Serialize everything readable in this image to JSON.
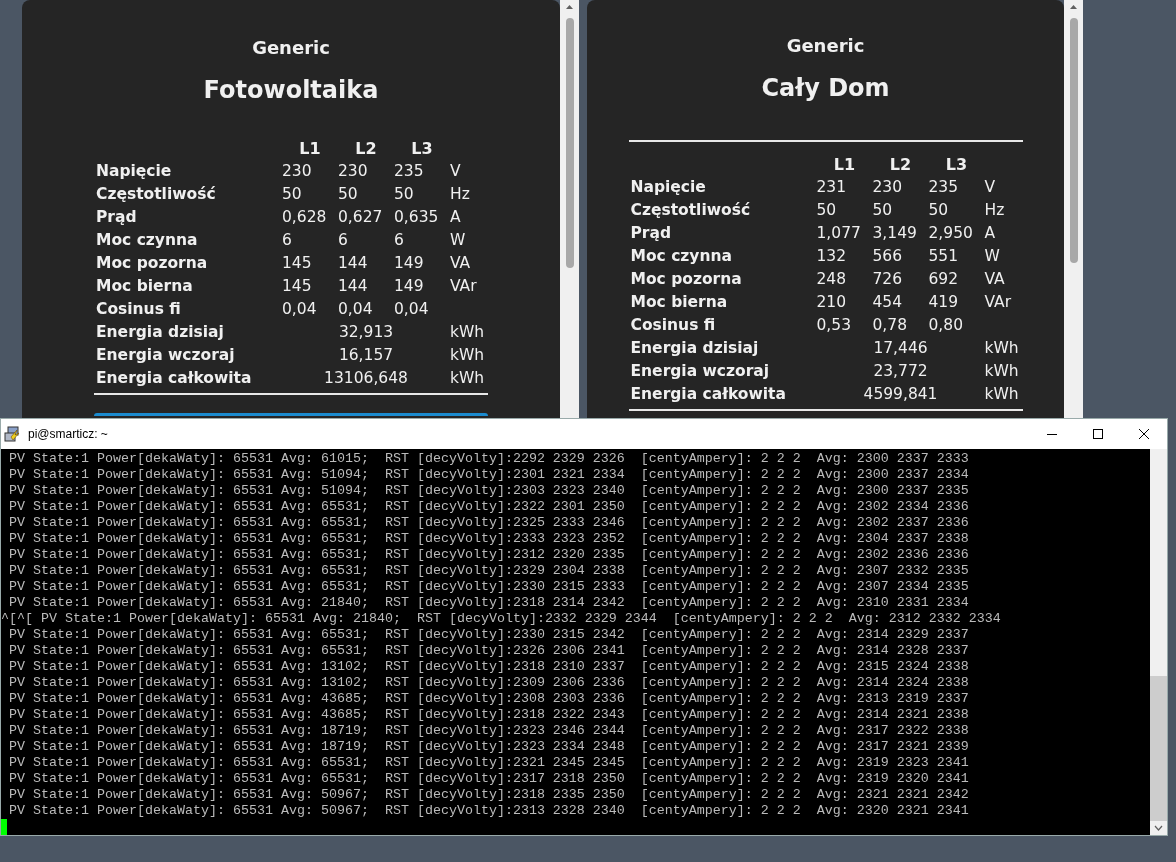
{
  "panels": [
    {
      "subtitle": "Generic",
      "title": "Fotowoltaika",
      "divider_above": false,
      "columns": [
        "L1",
        "L2",
        "L3"
      ],
      "rows": [
        {
          "kind": "phases",
          "label": "Napięcie",
          "values": [
            "230",
            "230",
            "235"
          ],
          "unit": "V"
        },
        {
          "kind": "phases",
          "label": "Częstotliwość",
          "values": [
            "50",
            "50",
            "50"
          ],
          "unit": "Hz"
        },
        {
          "kind": "phases",
          "label": "Prąd",
          "values": [
            "0,628",
            "0,627",
            "0,635"
          ],
          "unit": "A"
        },
        {
          "kind": "phases",
          "label": "Moc czynna",
          "values": [
            "6",
            "6",
            "6"
          ],
          "unit": "W"
        },
        {
          "kind": "phases",
          "label": "Moc pozorna",
          "values": [
            "145",
            "144",
            "149"
          ],
          "unit": "VA"
        },
        {
          "kind": "phases",
          "label": "Moc bierna",
          "values": [
            "145",
            "144",
            "149"
          ],
          "unit": "VAr"
        },
        {
          "kind": "phases",
          "label": "Cosinus fi",
          "values": [
            "0,04",
            "0,04",
            "0,04"
          ]
        },
        {
          "kind": "total",
          "label": "Energia dzisiaj",
          "value": "32,913",
          "unit": "kWh"
        },
        {
          "kind": "total",
          "label": "Energia wczoraj",
          "value": "16,157",
          "unit": "kWh"
        },
        {
          "kind": "total",
          "label": "Energia całkowita",
          "value": "13106,648",
          "unit": "kWh"
        }
      ]
    },
    {
      "subtitle": "Generic",
      "title": "Cały Dom",
      "divider_above": true,
      "columns": [
        "L1",
        "L2",
        "L3"
      ],
      "rows": [
        {
          "kind": "phases",
          "label": "Napięcie",
          "values": [
            "231",
            "230",
            "235"
          ],
          "unit": "V"
        },
        {
          "kind": "phases",
          "label": "Częstotliwość",
          "values": [
            "50",
            "50",
            "50"
          ],
          "unit": "Hz"
        },
        {
          "kind": "phases",
          "label": "Prąd",
          "values": [
            "1,077",
            "3,149",
            "2,950"
          ],
          "unit": "A"
        },
        {
          "kind": "phases",
          "label": "Moc czynna",
          "values": [
            "132",
            "566",
            "551"
          ],
          "unit": "W"
        },
        {
          "kind": "phases",
          "label": "Moc pozorna",
          "values": [
            "248",
            "726",
            "692"
          ],
          "unit": "VA"
        },
        {
          "kind": "phases",
          "label": "Moc bierna",
          "values": [
            "210",
            "454",
            "419"
          ],
          "unit": "VAr"
        },
        {
          "kind": "phases",
          "label": "Cosinus fi",
          "values": [
            "0,53",
            "0,78",
            "0,80"
          ]
        },
        {
          "kind": "total",
          "label": "Energia dzisiaj",
          "value": "17,446",
          "unit": "kWh"
        },
        {
          "kind": "total",
          "label": "Energia wczoraj",
          "value": "23,772",
          "unit": "kWh"
        },
        {
          "kind": "total",
          "label": "Energia całkowita",
          "value": "4599,841",
          "unit": "kWh"
        }
      ]
    }
  ],
  "terminal": {
    "title": "pi@smarticz: ~",
    "lines": [
      " PV State:1 Power[dekaWaty]: 65531 Avg: 61015;  RST [decyVolty]:2292 2329 2326  [centyAmpery]: 2 2 2  Avg: 2300 2337 2333",
      " PV State:1 Power[dekaWaty]: 65531 Avg: 51094;  RST [decyVolty]:2301 2321 2334  [centyAmpery]: 2 2 2  Avg: 2300 2337 2334",
      " PV State:1 Power[dekaWaty]: 65531 Avg: 51094;  RST [decyVolty]:2303 2323 2340  [centyAmpery]: 2 2 2  Avg: 2300 2337 2335",
      " PV State:1 Power[dekaWaty]: 65531 Avg: 65531;  RST [decyVolty]:2322 2301 2350  [centyAmpery]: 2 2 2  Avg: 2302 2334 2336",
      " PV State:1 Power[dekaWaty]: 65531 Avg: 65531;  RST [decyVolty]:2325 2333 2346  [centyAmpery]: 2 2 2  Avg: 2302 2337 2336",
      " PV State:1 Power[dekaWaty]: 65531 Avg: 65531;  RST [decyVolty]:2333 2323 2352  [centyAmpery]: 2 2 2  Avg: 2304 2337 2338",
      " PV State:1 Power[dekaWaty]: 65531 Avg: 65531;  RST [decyVolty]:2312 2320 2335  [centyAmpery]: 2 2 2  Avg: 2302 2336 2336",
      " PV State:1 Power[dekaWaty]: 65531 Avg: 65531;  RST [decyVolty]:2329 2304 2338  [centyAmpery]: 2 2 2  Avg: 2307 2332 2335",
      " PV State:1 Power[dekaWaty]: 65531 Avg: 65531;  RST [decyVolty]:2330 2315 2333  [centyAmpery]: 2 2 2  Avg: 2307 2334 2335",
      " PV State:1 Power[dekaWaty]: 65531 Avg: 21840;  RST [decyVolty]:2318 2314 2342  [centyAmpery]: 2 2 2  Avg: 2310 2331 2334",
      "^[^[ PV State:1 Power[dekaWaty]: 65531 Avg: 21840;  RST [decyVolty]:2332 2329 2344  [centyAmpery]: 2 2 2  Avg: 2312 2332 2334",
      " PV State:1 Power[dekaWaty]: 65531 Avg: 65531;  RST [decyVolty]:2330 2315 2342  [centyAmpery]: 2 2 2  Avg: 2314 2329 2337",
      " PV State:1 Power[dekaWaty]: 65531 Avg: 65531;  RST [decyVolty]:2326 2306 2341  [centyAmpery]: 2 2 2  Avg: 2314 2328 2337",
      " PV State:1 Power[dekaWaty]: 65531 Avg: 13102;  RST [decyVolty]:2318 2310 2337  [centyAmpery]: 2 2 2  Avg: 2315 2324 2338",
      " PV State:1 Power[dekaWaty]: 65531 Avg: 13102;  RST [decyVolty]:2309 2306 2336  [centyAmpery]: 2 2 2  Avg: 2314 2324 2338",
      " PV State:1 Power[dekaWaty]: 65531 Avg: 43685;  RST [decyVolty]:2308 2303 2336  [centyAmpery]: 2 2 2  Avg: 2313 2319 2337",
      " PV State:1 Power[dekaWaty]: 65531 Avg: 43685;  RST [decyVolty]:2318 2322 2343  [centyAmpery]: 2 2 2  Avg: 2314 2321 2338",
      " PV State:1 Power[dekaWaty]: 65531 Avg: 18719;  RST [decyVolty]:2323 2346 2344  [centyAmpery]: 2 2 2  Avg: 2317 2322 2338",
      " PV State:1 Power[dekaWaty]: 65531 Avg: 18719;  RST [decyVolty]:2323 2334 2348  [centyAmpery]: 2 2 2  Avg: 2317 2321 2339",
      " PV State:1 Power[dekaWaty]: 65531 Avg: 65531;  RST [decyVolty]:2321 2345 2345  [centyAmpery]: 2 2 2  Avg: 2319 2323 2341",
      " PV State:1 Power[dekaWaty]: 65531 Avg: 65531;  RST [decyVolty]:2317 2318 2350  [centyAmpery]: 2 2 2  Avg: 2319 2320 2341",
      " PV State:1 Power[dekaWaty]: 65531 Avg: 50967;  RST [decyVolty]:2318 2335 2350  [centyAmpery]: 2 2 2  Avg: 2321 2321 2342",
      " PV State:1 Power[dekaWaty]: 65531 Avg: 50967;  RST [decyVolty]:2313 2328 2340  [centyAmpery]: 2 2 2  Avg: 2320 2321 2341"
    ]
  }
}
